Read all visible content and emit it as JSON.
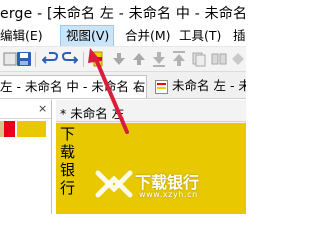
{
  "window": {
    "title": "erge - [未命名 左 - 未命名 中 - 未命名 右]"
  },
  "menubar": {
    "items": [
      {
        "label": "编辑(E)"
      },
      {
        "label": "视图(V)"
      },
      {
        "label": "合并(M)"
      },
      {
        "label": "工具(T)"
      },
      {
        "label": "插"
      }
    ]
  },
  "toolbar": {
    "icons": [
      "save-icon",
      "undo-icon",
      "redo-icon",
      "compare-icon",
      "next-diff-icon",
      "prev-diff-icon",
      "push-down-icon",
      "push-up-icon",
      "copy-icon",
      "merge-icon",
      "merge-all-icon"
    ]
  },
  "tabs": [
    {
      "label": "左 - 未命名 中 - 未命名 右",
      "close": "×"
    },
    {
      "label": "未命名 左 - 未命"
    }
  ],
  "left_panel": {
    "close": "×",
    "colors": {
      "red": "#e8001c",
      "yellow": "#e8c800",
      "tan": "#d8c58c"
    }
  },
  "editor": {
    "header": "* 未命名 左",
    "lines": [
      "下",
      "载",
      "银",
      "行"
    ],
    "highlight_color": "#e8c800"
  },
  "watermark": {
    "text": "下载银行",
    "url": "www.xzyh.cn"
  },
  "colors": {
    "menu_highlight": "#cce4f7",
    "menu_highlight_border": "#99c9ef",
    "annotation_arrow": "#d81e3a"
  }
}
